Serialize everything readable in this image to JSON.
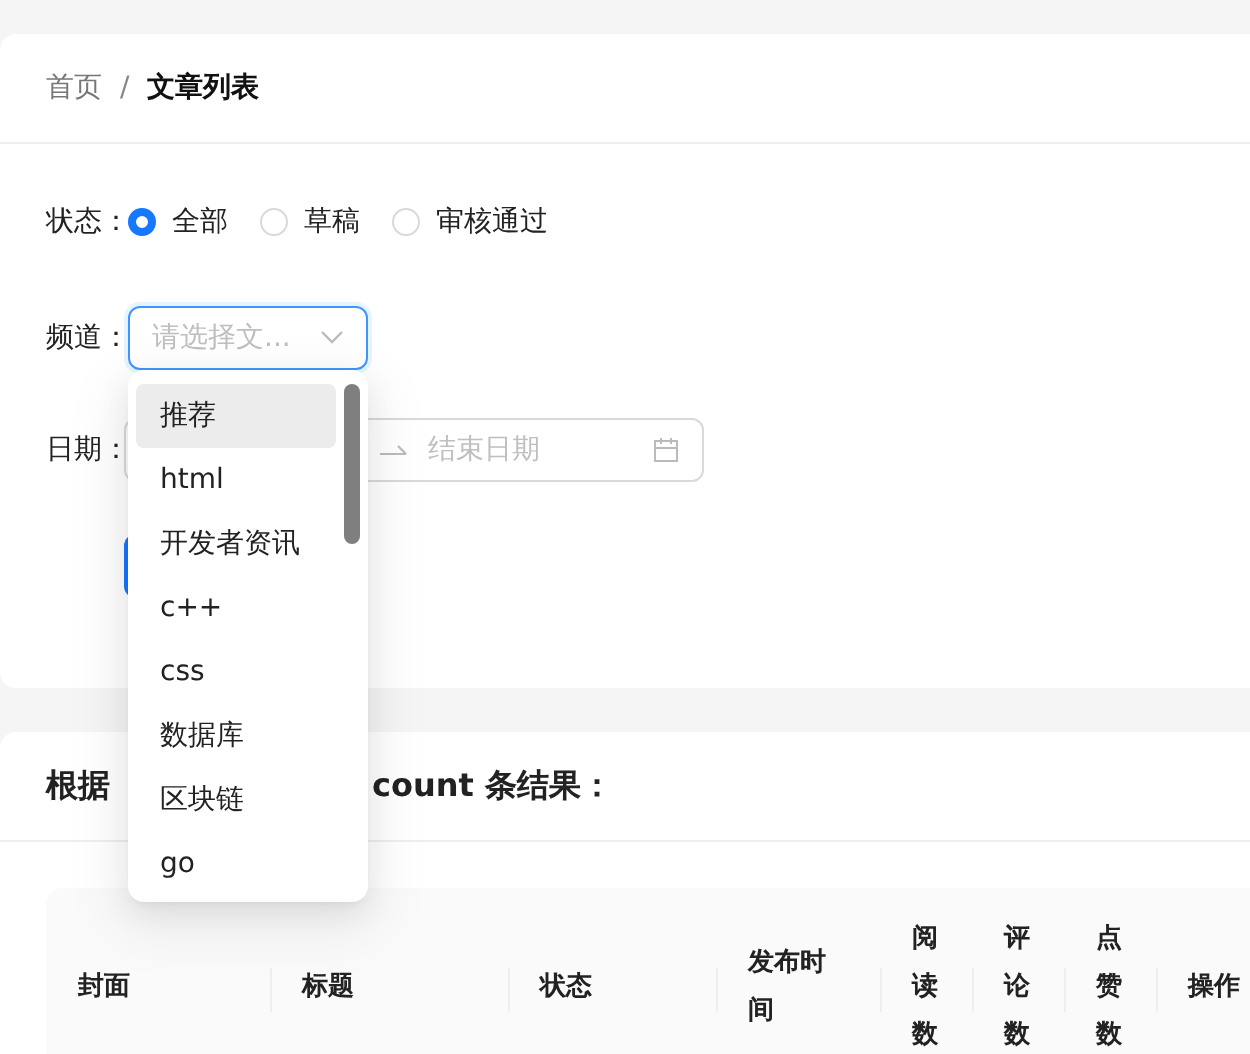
{
  "breadcrumb": [
    {
      "label": "首页",
      "current": false
    },
    {
      "label": "文章列表",
      "current": true
    }
  ],
  "breadcrumb_separator": "/",
  "filters": {
    "status": {
      "label": "状态：",
      "options": [
        {
          "label": "全部",
          "selected": true
        },
        {
          "label": "草稿",
          "selected": false
        },
        {
          "label": "审核通过",
          "selected": false
        }
      ]
    },
    "channel": {
      "label": "频道：",
      "placeholder": "请选择文...",
      "focused": true,
      "open": true,
      "options": [
        {
          "label": "推荐",
          "hovered": true
        },
        {
          "label": "html",
          "hovered": false
        },
        {
          "label": "开发者资讯",
          "hovered": false
        },
        {
          "label": "c++",
          "hovered": false
        },
        {
          "label": "css",
          "hovered": false
        },
        {
          "label": "数据库",
          "hovered": false
        },
        {
          "label": "区块链",
          "hovered": false
        },
        {
          "label": "go",
          "hovered": false
        }
      ]
    },
    "date": {
      "label": "日期：",
      "end_placeholder": "结束日期"
    }
  },
  "results": {
    "title_start": "根据",
    "title_end": "count 条结果："
  },
  "table": {
    "columns": [
      "封面",
      "标题",
      "状态",
      "发布时间",
      "阅读数",
      "评论数",
      "点赞数",
      "操作"
    ]
  }
}
